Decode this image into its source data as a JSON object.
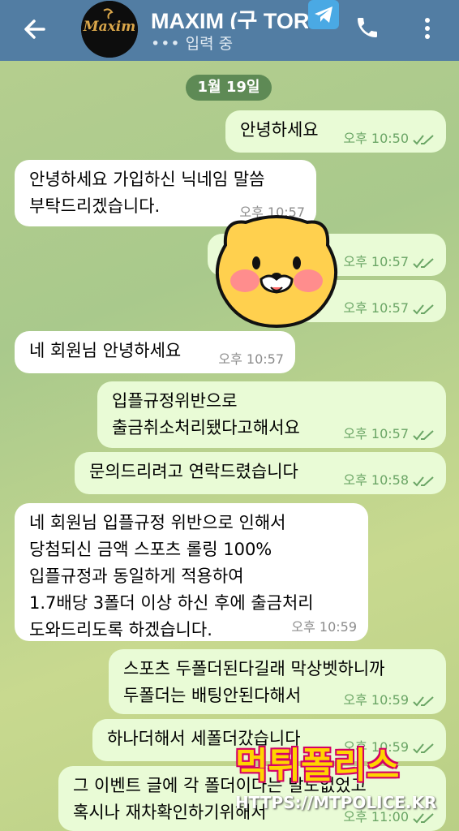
{
  "header": {
    "title": "MAXIM (구 TOR",
    "status": "입력 중",
    "avatar_logo": "Maxim",
    "back_icon": "arrow-left-icon",
    "call_icon": "phone-icon",
    "menu_icon": "more-vertical-icon",
    "telegram_badge_icon": "telegram-icon",
    "bar_color": "#527da3"
  },
  "date_separator": "1월 19일",
  "messages": [
    {
      "dir": "out",
      "text": [
        "안녕하세요"
      ],
      "time": "오후 10:50",
      "read": true
    },
    {
      "dir": "in",
      "text": [
        "안녕하세요 가입하신 닉네임 말씀",
        "부탁드리겠습니다."
      ],
      "time": "오후 10:57"
    },
    {
      "dir": "out",
      "text": [
        ""
      ],
      "time": "오후 10:57",
      "read": true
    },
    {
      "dir": "out",
      "text": [
        ""
      ],
      "time": "오후 10:57",
      "read": true
    },
    {
      "dir": "in",
      "text": [
        "네 회원님 안녕하세요"
      ],
      "time": "오후 10:57"
    },
    {
      "dir": "out",
      "text": [
        "입플규정위반으로",
        "출금취소처리됐다고해서요"
      ],
      "time": "오후 10:57",
      "read": true
    },
    {
      "dir": "out",
      "text": [
        "문의드리려고 연락드렸습니다"
      ],
      "time": "오후 10:58",
      "read": true
    },
    {
      "dir": "in",
      "text": [
        "네 회원님 입플규정 위반으로 인해서",
        "당첨되신 금액 스포츠 롤링 100%",
        "입플규정과 동일하게 적용하여",
        "1.7배당 3폴더 이상 하신 후에 출금처리",
        "도와드리도록 하겠습니다."
      ],
      "time": "오후 10:59"
    },
    {
      "dir": "out",
      "text": [
        "스포츠 두폴더된다길래 막상벳하니까",
        "두폴더는 배팅안된다해서"
      ],
      "time": "오후 10:59",
      "read": true
    },
    {
      "dir": "out",
      "text": [
        "하나더해서 세폴더갔습니다"
      ],
      "time": "오후 10:59",
      "read": true
    },
    {
      "dir": "out",
      "text": [
        "그 이벤트 글에 각 폴더이다는 말도없었고",
        "혹시나 재차확인하기위해서"
      ],
      "time": "오후 11:00",
      "read": true
    }
  ],
  "watermark": {
    "title": "먹튀폴리스",
    "url": "HTTPS://MTPOLICE.KR"
  },
  "colors": {
    "incoming_bubble": "#ffffff",
    "outgoing_bubble": "#e9fbd6",
    "date_pill": "#5e8a55",
    "read_ticks": "#6aa565"
  }
}
